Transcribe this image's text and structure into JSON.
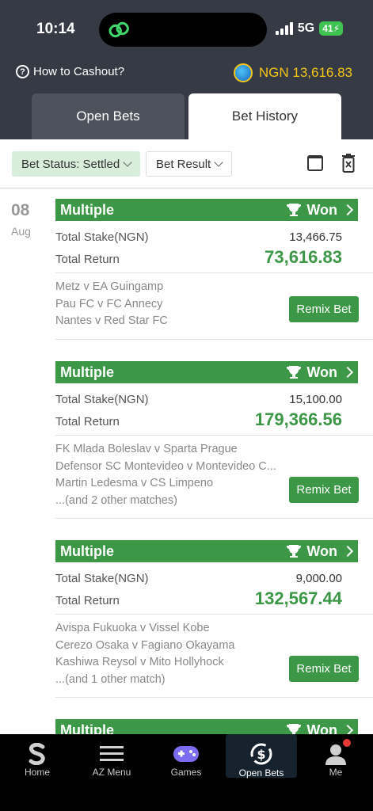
{
  "status_bar": {
    "time": "10:14",
    "network": "5G",
    "battery": "41"
  },
  "header": {
    "howto_label": "How to Cashout?",
    "balance": "NGN 13,616.83",
    "tabs": [
      {
        "label": "Open Bets",
        "active": false
      },
      {
        "label": "Bet History",
        "active": true
      }
    ]
  },
  "filters": {
    "status_label": "Bet Status: Settled",
    "result_label": "Bet Result"
  },
  "date_group": {
    "day": "08",
    "month": "Aug"
  },
  "bets": [
    {
      "type": "Multiple",
      "result": "Won",
      "stake_label": "Total Stake(NGN)",
      "stake": "13,466.75",
      "return_label": "Total Return",
      "return": "73,616.83",
      "matches": [
        "Metz v EA Guingamp",
        "Pau FC v FC Annecy",
        "Nantes v Red Star FC"
      ],
      "remix_label": "Remix Bet"
    },
    {
      "type": "Multiple",
      "result": "Won",
      "stake_label": "Total Stake(NGN)",
      "stake": "15,100.00",
      "return_label": "Total Return",
      "return": "179,366.56",
      "matches": [
        "FK Mlada Boleslav v Sparta Prague",
        "Defensor SC Montevideo v Montevideo C...",
        "Martin Ledesma v CS Limpeno",
        "...(and 2 other matches)"
      ],
      "remix_label": "Remix Bet"
    },
    {
      "type": "Multiple",
      "result": "Won",
      "stake_label": "Total Stake(NGN)",
      "stake": "9,000.00",
      "return_label": "Total Return",
      "return": "132,567.44",
      "matches": [
        "Avispa Fukuoka v Vissel Kobe",
        "Cerezo Osaka v Fagiano Okayama",
        "Kashiwa Reysol v Mito Hollyhock",
        "...(and 1 other match)"
      ],
      "remix_label": "Remix Bet"
    },
    {
      "type": "Multiple",
      "result": "Won"
    }
  ],
  "nav": [
    {
      "label": "Home",
      "icon": "sporty-logo-icon"
    },
    {
      "label": "AZ Menu",
      "icon": "menu-icon"
    },
    {
      "label": "Games",
      "icon": "gamepad-icon"
    },
    {
      "label": "Open Bets",
      "icon": "open-bets-icon",
      "active": true
    },
    {
      "label": "Me",
      "icon": "user-icon",
      "badge": true
    }
  ],
  "colors": {
    "accent_green": "#3c9746",
    "header_bg": "#353a45",
    "balance_gold": "#f5c518"
  }
}
